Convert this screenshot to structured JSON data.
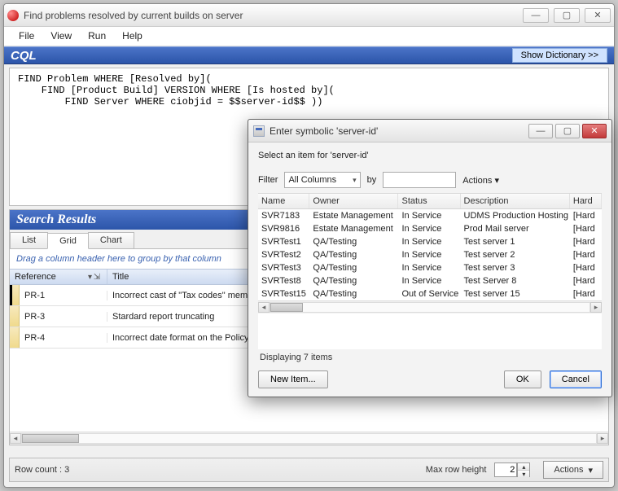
{
  "main": {
    "title": "Find problems resolved by current builds on server",
    "menu": {
      "file": "File",
      "view": "View",
      "run": "Run",
      "help": "Help"
    },
    "cql": {
      "label": "CQL",
      "show_dict": "Show Dictionary >>",
      "query": "FIND Problem WHERE [Resolved by](\n    FIND [Product Build] VERSION WHERE [Is hosted by](\n        FIND Server WHERE ciobjid = $$server-id$$ ))"
    },
    "search": {
      "header": "Search Results",
      "tabs": {
        "list": "List",
        "grid": "Grid",
        "chart": "Chart"
      },
      "group_hint": "Drag a column header here to group by that column",
      "cols": {
        "ref": "Reference",
        "title": "Title"
      },
      "rows": [
        {
          "ref": "PR-1",
          "title": "Incorrect cast of \"Tax codes\" mem"
        },
        {
          "ref": "PR-3",
          "title": "Stardard report truncating"
        },
        {
          "ref": "PR-4",
          "title": "Incorrect date format on the Policy"
        }
      ]
    },
    "status": {
      "row_count": "Row count : 3",
      "max_row_label": "Max row height",
      "max_row_value": "2",
      "actions": "Actions"
    }
  },
  "dialog": {
    "title": "Enter symbolic 'server-id'",
    "prompt": "Select an item for 'server-id'",
    "filter": {
      "label": "Filter",
      "column": "All Columns",
      "by": "by",
      "actions": "Actions"
    },
    "cols": {
      "name": "Name",
      "owner": "Owner",
      "status": "Status",
      "desc": "Description",
      "hard": "Hard"
    },
    "rows": [
      {
        "name": "SVR7183",
        "owner": "Estate Management",
        "status": "In Service",
        "desc": "UDMS Production Hosting box",
        "hard": "[Hard"
      },
      {
        "name": "SVR9816",
        "owner": "Estate Management",
        "status": "In Service",
        "desc": "Prod Mail server",
        "hard": "[Hard"
      },
      {
        "name": "SVRTest1",
        "owner": "QA/Testing",
        "status": "In Service",
        "desc": "Test server 1",
        "hard": "[Hard"
      },
      {
        "name": "SVRTest2",
        "owner": "QA/Testing",
        "status": "In Service",
        "desc": "Test server 2",
        "hard": "[Hard"
      },
      {
        "name": "SVRTest3",
        "owner": "QA/Testing",
        "status": "In Service",
        "desc": "Test server 3",
        "hard": "[Hard"
      },
      {
        "name": "SVRTest8",
        "owner": "QA/Testing",
        "status": "In Service",
        "desc": "Test Server 8",
        "hard": "[Hard"
      },
      {
        "name": "SVRTest15",
        "owner": "QA/Testing",
        "status": "Out of Service",
        "desc": "Test server 15",
        "hard": "[Hard"
      }
    ],
    "status": "Displaying 7 items",
    "buttons": {
      "new": "New Item...",
      "ok": "OK",
      "cancel": "Cancel"
    }
  }
}
